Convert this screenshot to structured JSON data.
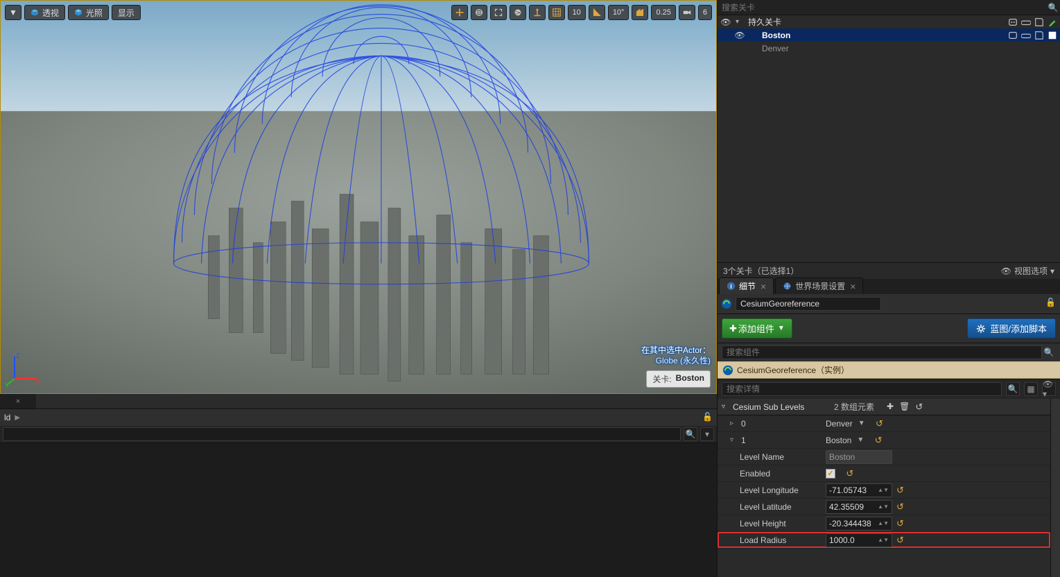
{
  "viewport": {
    "topLeftButtons": {
      "arrow": "▼",
      "perspective": "透视",
      "lighting": "光照",
      "display": "显示"
    },
    "topRight": {
      "snap1": "10",
      "angleVal": "10°",
      "scaleVal": "0.25",
      "camSpeed": "6"
    },
    "callout_l1": "在其中选中Actor：",
    "callout_l2": "Globe (永久性)",
    "levelChip": {
      "k": "关卡:",
      "v": "Boston"
    }
  },
  "contentBrowser": {
    "crumb": "ld",
    "chev": "▶"
  },
  "levelsPanel": {
    "searchPlaceholder": "搜索关卡",
    "items": [
      {
        "label": "持久关卡",
        "sel": false,
        "indent": 0,
        "arrow": "▾"
      },
      {
        "label": "Boston",
        "sel": true,
        "indent": 1,
        "arrow": ""
      },
      {
        "label": "Denver",
        "sel": false,
        "indent": 1,
        "arrow": "",
        "dim": true
      }
    ],
    "footer_count": "3个关卡（已选择1）",
    "footer_opts": "视图选项"
  },
  "details": {
    "tab_details": "细节",
    "tab_world": "世界场景设置",
    "actor_name": "CesiumGeoreference",
    "btn_add": "添加组件",
    "btn_blueprint": "蓝图/添加脚本",
    "comp_search_placeholder": "搜索组件",
    "comp_root": "CesiumGeoreference（实例）",
    "prop_search_placeholder": "搜索详情",
    "section_title": "Cesium Sub Levels",
    "section_count": "2 数组元素",
    "idx0_label": "0",
    "idx0_value": "Denver",
    "idx1_label": "1",
    "idx1_value": "Boston",
    "props": {
      "level_name_k": "Level Name",
      "level_name_v": "Boston",
      "enabled_k": "Enabled",
      "lon_k": "Level Longitude",
      "lon_v": "-71.05743",
      "lat_k": "Level Latitude",
      "lat_v": "42.35509",
      "height_k": "Level Height",
      "height_v": "-20.344438",
      "radius_k": "Load Radius",
      "radius_v": "1000.0"
    }
  }
}
